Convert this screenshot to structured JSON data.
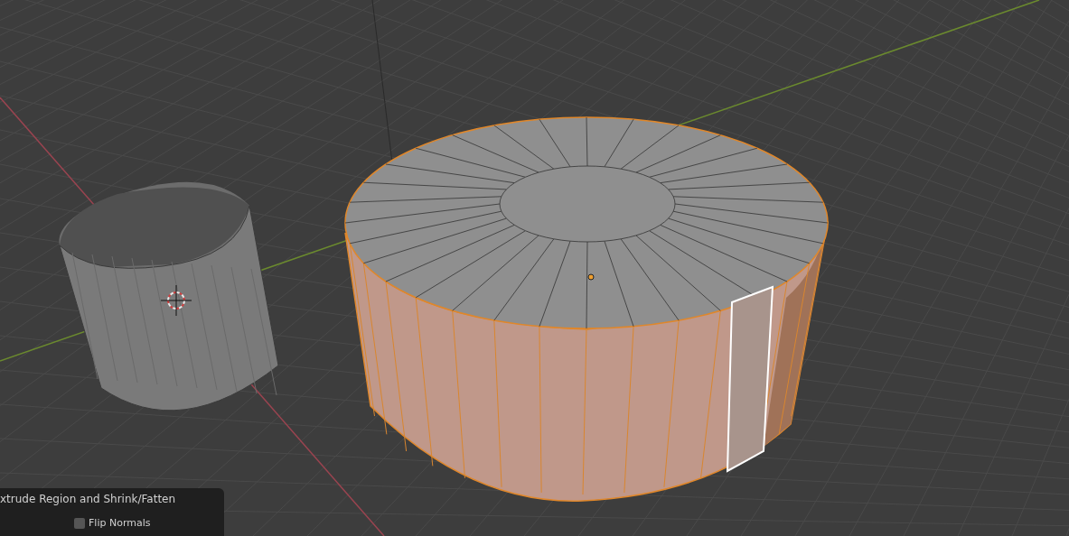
{
  "operator_panel": {
    "title": "xtrude Region and Shrink/Fatten",
    "options": [
      {
        "kind": "checkbox",
        "label": "Flip Normals",
        "checked": false
      }
    ]
  }
}
